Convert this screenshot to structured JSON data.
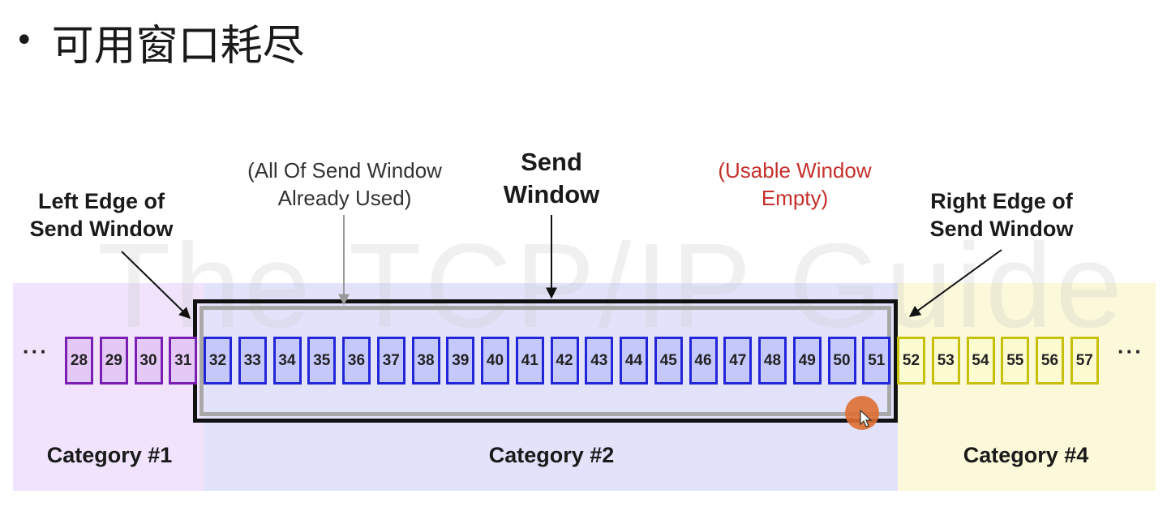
{
  "title": "可用窗口耗尽",
  "bullet": "•",
  "watermark": "The TCP/IP Guide",
  "labels": {
    "left_edge_line1": "Left Edge of",
    "left_edge_line2": "Send Window",
    "right_edge_line1": "Right Edge of",
    "right_edge_line2": "Send Window",
    "send_window_line1": "Send",
    "send_window_line2": "Window",
    "all_used_line1": "(All Of Send Window",
    "all_used_line2": "Already Used)",
    "usable_empty_line1": "(Usable Window",
    "usable_empty_line2": "Empty)"
  },
  "ellipsis": "···",
  "categories": {
    "cat1": "Category #1",
    "cat2": "Category #2",
    "cat4": "Category #4"
  },
  "cells_cat1": [
    "28",
    "29",
    "30",
    "31"
  ],
  "cells_cat2": [
    "32",
    "33",
    "34",
    "35",
    "36",
    "37",
    "38",
    "39",
    "40",
    "41",
    "42",
    "43",
    "44",
    "45",
    "46",
    "47",
    "48",
    "49",
    "50",
    "51"
  ],
  "cells_cat4": [
    "52",
    "53",
    "54",
    "55",
    "56",
    "57"
  ],
  "colors": {
    "cat1_fill": "#e4c8f5",
    "cat1_border": "#7a1fb4",
    "cat2_fill": "#c4c8fb",
    "cat2_border": "#2226d8",
    "cat4_fill": "#fdfbd0",
    "cat4_border": "#c7c00a",
    "usable_text": "#c4302b"
  }
}
